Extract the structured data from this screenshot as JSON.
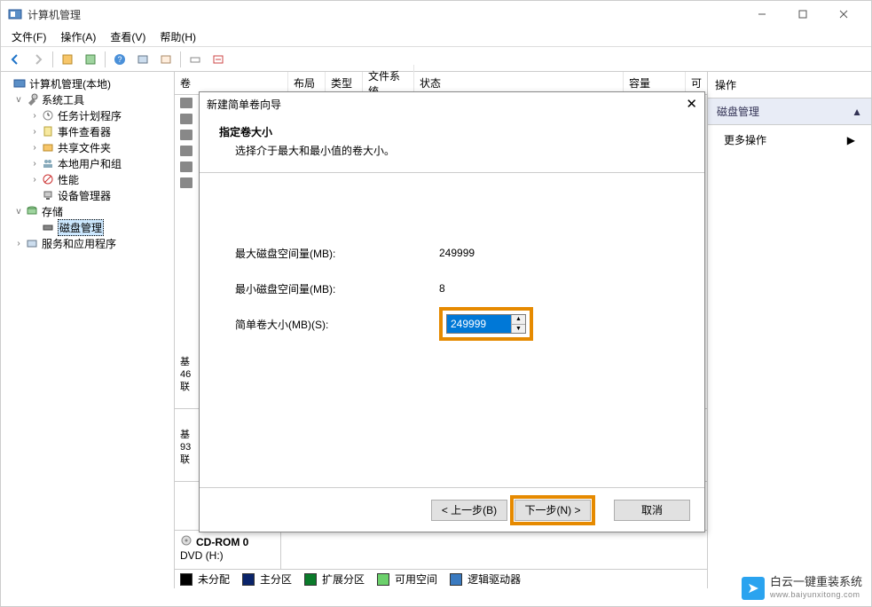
{
  "window": {
    "title": "计算机管理"
  },
  "menu": {
    "file": "文件(F)",
    "action": "操作(A)",
    "view": "查看(V)",
    "help": "帮助(H)"
  },
  "tree": {
    "root": "计算机管理(本地)",
    "systools": "系统工具",
    "task": "任务计划程序",
    "event": "事件查看器",
    "shared": "共享文件夹",
    "users": "本地用户和组",
    "perf": "性能",
    "devmgr": "设备管理器",
    "storage": "存储",
    "diskmgmt": "磁盘管理",
    "services": "服务和应用程序"
  },
  "columns": {
    "vol": "卷",
    "layout": "布局",
    "type": "类型",
    "fs": "文件系统",
    "status": "状态",
    "capacity": "容量",
    "free": "可"
  },
  "disks": {
    "basic_prefix": "基",
    "size1": "46",
    "size2": "93",
    "online_prefix": "联",
    "cdrom_title": "CD-ROM 0",
    "cdrom_sub": "DVD (H:)"
  },
  "legend": {
    "unalloc": "未分配",
    "primary": "主分区",
    "ext": "扩展分区",
    "free": "可用空间",
    "logical": "逻辑驱动器"
  },
  "actions": {
    "header": "操作",
    "group": "磁盘管理",
    "more": "更多操作"
  },
  "wizard": {
    "title": "新建简单卷向导",
    "head1": "指定卷大小",
    "head2": "选择介于最大和最小值的卷大小。",
    "max_label": "最大磁盘空间量(MB):",
    "max_value": "249999",
    "min_label": "最小磁盘空间量(MB):",
    "min_value": "8",
    "size_label": "简单卷大小(MB)(S):",
    "size_value": "249999",
    "back": "< 上一步(B)",
    "next": "下一步(N) >",
    "cancel": "取消"
  },
  "watermark": {
    "main": "白云一键重装系统",
    "sub": "www.baiyunxitong.com"
  }
}
